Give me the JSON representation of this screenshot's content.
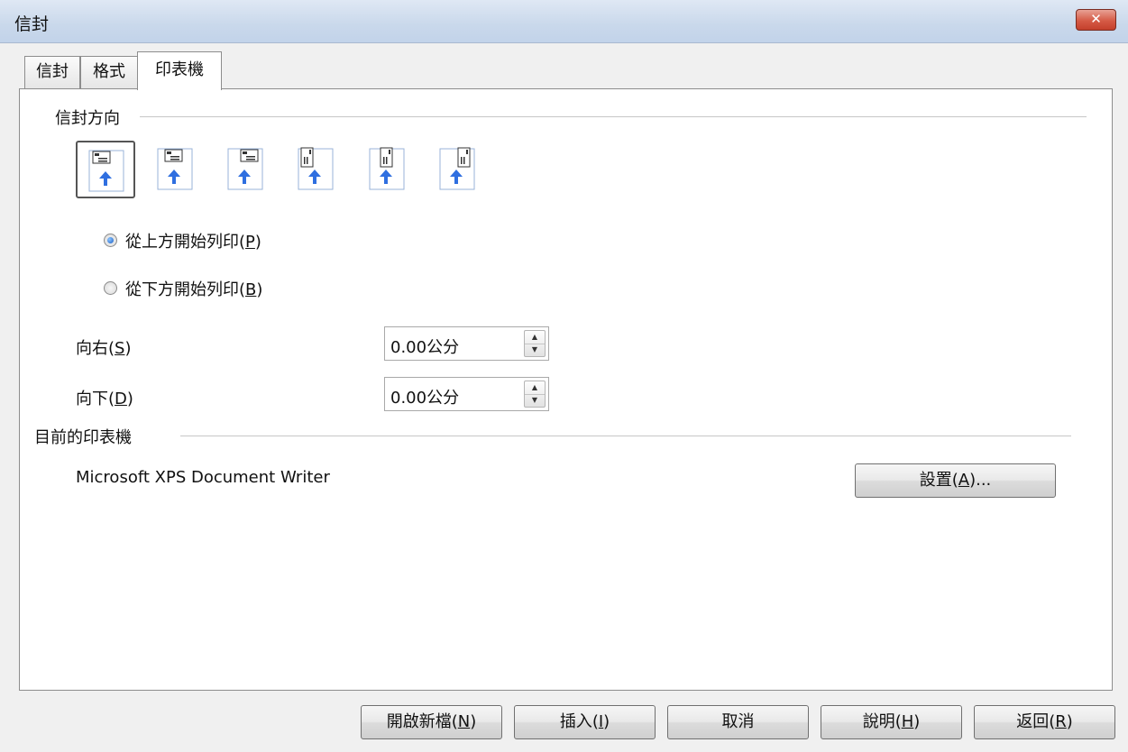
{
  "window": {
    "title": "信封",
    "close_glyph": "✕"
  },
  "tabs": [
    {
      "label": "信封",
      "active": false
    },
    {
      "label": "格式",
      "active": false
    },
    {
      "label": "印表機",
      "active": true
    }
  ],
  "orientation": {
    "section_label": "信封方向",
    "options": [
      {
        "icon": "envelope-landscape-left-icon",
        "selected": true
      },
      {
        "icon": "envelope-landscape-center-icon",
        "selected": false
      },
      {
        "icon": "envelope-landscape-right-icon",
        "selected": false
      },
      {
        "icon": "envelope-portrait-left-icon",
        "selected": false
      },
      {
        "icon": "envelope-portrait-center-icon",
        "selected": false
      },
      {
        "icon": "envelope-portrait-right-icon",
        "selected": false
      }
    ],
    "radio_top": {
      "text": "從上方開始列印",
      "mn_open": "(",
      "mn_key": "P",
      "mn_close": ")",
      "checked": true
    },
    "radio_bottom": {
      "text": "從下方開始列印",
      "mn_open": "(",
      "mn_key": "B",
      "mn_close": ")",
      "checked": false
    }
  },
  "shift_right": {
    "text": "向右",
    "mn_open": "(",
    "mn_key": "S",
    "mn_close": ")",
    "value": "0.00公分"
  },
  "shift_down": {
    "text": "向下",
    "mn_open": "(",
    "mn_key": "D",
    "mn_close": ")",
    "value": "0.00公分"
  },
  "printer": {
    "section_label": "目前的印表機",
    "name": "Microsoft XPS Document Writer",
    "setup_button": {
      "text": "設置",
      "mn_open": "(",
      "mn_key": "A",
      "mn_close": ")...",
      "suffix": ""
    }
  },
  "footer_buttons": [
    {
      "text": "開啟新檔",
      "mn_open": "(",
      "mn_key": "N",
      "mn_close": ")"
    },
    {
      "text": "插入",
      "mn_open": "(",
      "mn_key": "I",
      "mn_close": ")"
    },
    {
      "text": "取消",
      "mn_open": "",
      "mn_key": "",
      "mn_close": ""
    },
    {
      "text": "說明",
      "mn_open": "(",
      "mn_key": "H",
      "mn_close": ")"
    },
    {
      "text": "返回",
      "mn_open": "(",
      "mn_key": "R",
      "mn_close": ")"
    }
  ],
  "colors": {
    "arrow": "#2f6fe0",
    "titlebar": "#c9d8eb",
    "close": "#c94a35"
  }
}
